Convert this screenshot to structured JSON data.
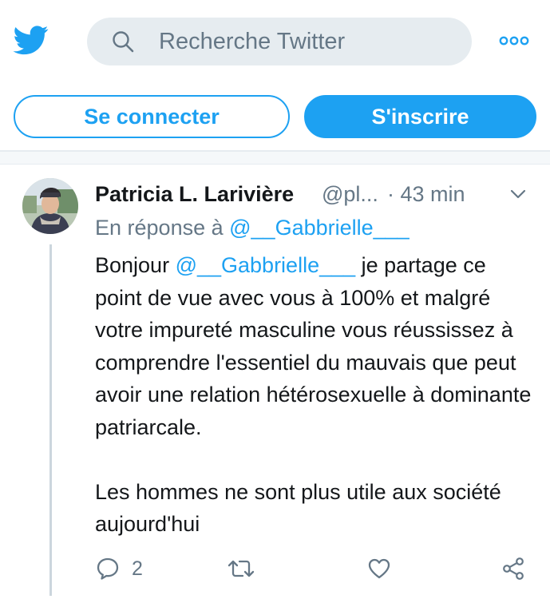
{
  "header": {
    "logo_icon": "twitter-bird-icon",
    "search": {
      "icon": "search-icon",
      "placeholder": "Recherche Twitter"
    },
    "more_icon": "more-dots-icon"
  },
  "auth": {
    "login_label": "Se connecter",
    "signup_label": "S'inscrire"
  },
  "tweet": {
    "author_name": "Patricia L. Larivière",
    "author_handle": "@pl...",
    "time": "· 43 min",
    "reply_prefix": "En réponse à ",
    "reply_mention": "@__Gabbrielle___",
    "body": {
      "line1_prefix": "Bonjour ",
      "mention": "@__Gabbrielle___",
      "line1_suffix": " je partage ce point de vue avec vous à 100% et malgré votre impureté masculine vous réussissez à comprendre l'essentiel du mauvais que peut avoir une relation hétérosexuelle à dominante patriarcale.",
      "paragraph2": "Les hommes ne sont plus utile aux société aujourd'hui"
    },
    "actions": {
      "reply_count": "2"
    }
  },
  "colors": {
    "brand": "#1da1f2",
    "muted": "#657786",
    "text": "#14171a",
    "search_bg": "#e6ecf0"
  }
}
